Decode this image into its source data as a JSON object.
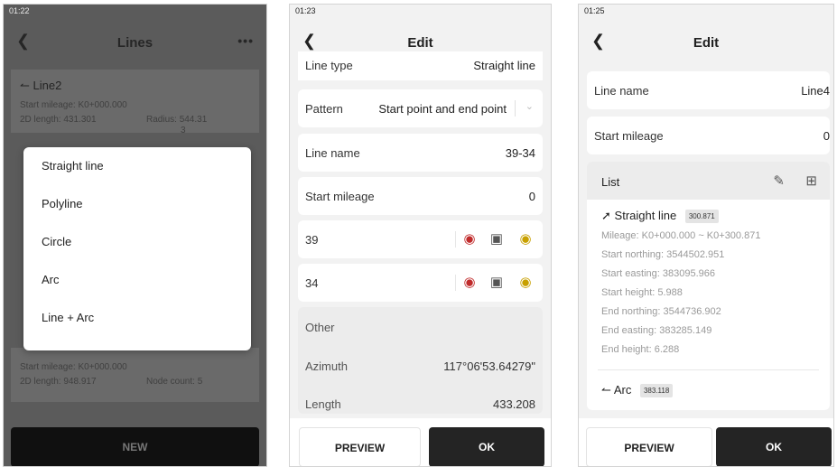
{
  "screen1": {
    "time": "01:22",
    "title": "Lines",
    "more": "•••",
    "line2": {
      "name": "Line2",
      "start_mileage": "Start mileage: K0+000.000",
      "length": "2D length: 431.301",
      "radius_label": "Radius:",
      "radius_value": "544.31",
      "radius_tail": "3"
    },
    "line5": {
      "start_mileage": "Start mileage: K0+000.000",
      "length": "2D length: 948.917",
      "node_count": "Node count: 5"
    },
    "menu": [
      "Straight line",
      "Polyline",
      "Circle",
      "Arc",
      "Line + Arc"
    ],
    "new_button": "NEW"
  },
  "screen2": {
    "time": "01:23",
    "title": "Edit",
    "line_type_label": "Line type",
    "line_type_value": "Straight line",
    "pattern_label": "Pattern",
    "pattern_value": "Start point and end point",
    "line_name_label": "Line name",
    "line_name_value": "39-34",
    "start_mileage_label": "Start mileage",
    "start_mileage_value": "0",
    "point1": "39",
    "point2": "34",
    "other_label": "Other",
    "azimuth_label": "Azimuth",
    "azimuth_value": "117°06'53.64279\"",
    "length_label": "Length",
    "length_value": "433.208",
    "preview_button": "PREVIEW",
    "ok_button": "OK"
  },
  "screen3": {
    "time": "01:25",
    "title": "Edit",
    "line_name_label": "Line name",
    "line_name_value": "Line4",
    "start_mileage_label": "Start mileage",
    "start_mileage_value": "0",
    "list_label": "List",
    "item1": {
      "type": "Straight line",
      "badge": "300.871",
      "mileage": "Mileage: K0+000.000 ~ K0+300.871",
      "start_northing": "Start northing: 3544502.951",
      "start_easting": "Start easting: 383095.966",
      "start_height": "Start height: 5.988",
      "end_northing": "End northing: 3544736.902",
      "end_easting": "End easting: 383285.149",
      "end_height": "End height: 6.288"
    },
    "item2": {
      "type": "Arc",
      "badge": "383.118"
    },
    "preview_button": "PREVIEW",
    "ok_button": "OK"
  },
  "icons": {
    "back": "chevron-left-icon",
    "target": "target-icon",
    "map_pin": "map-pin-icon"
  }
}
